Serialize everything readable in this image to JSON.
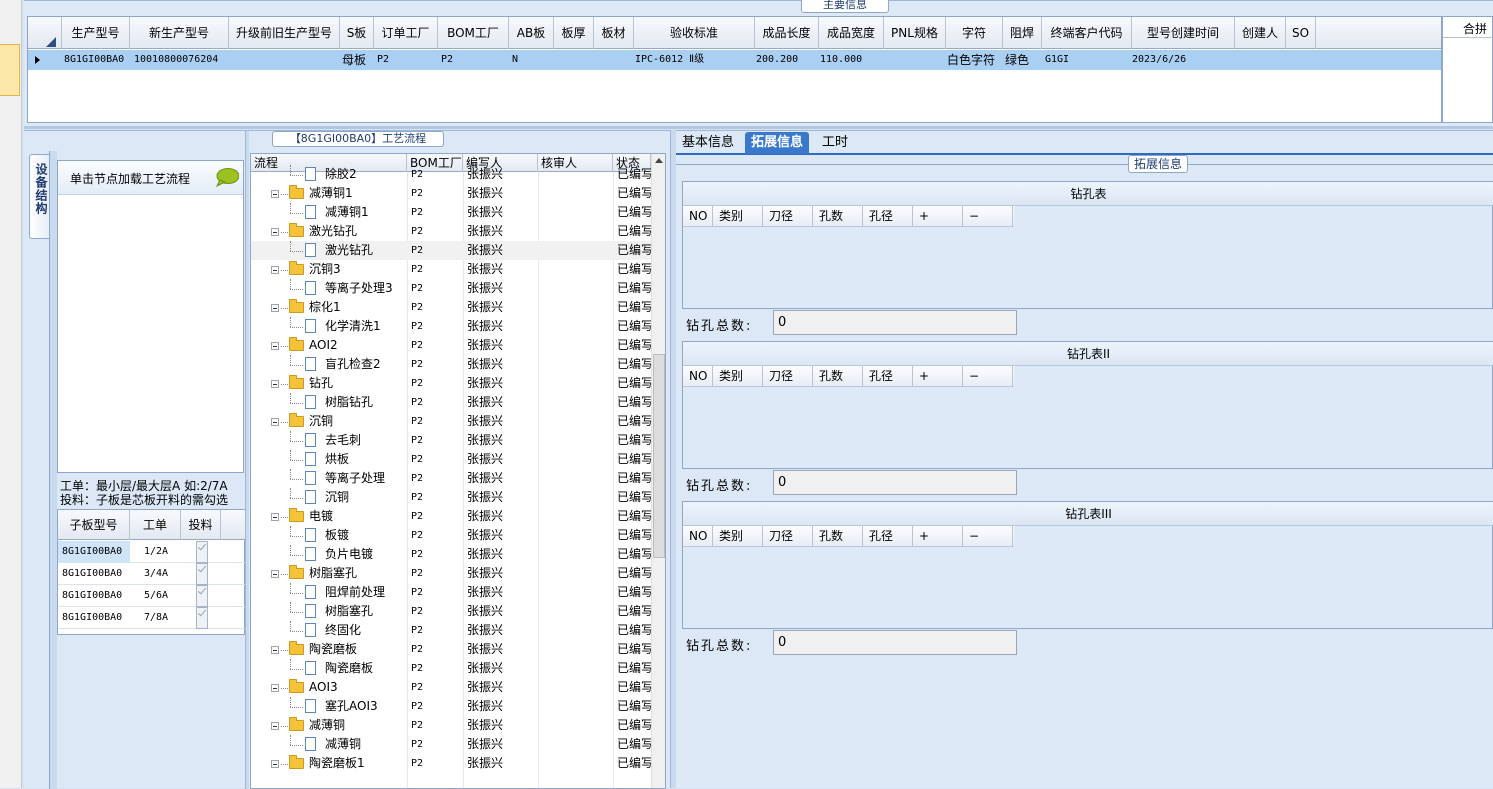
{
  "top_panel": {
    "title": "主要信息",
    "columns": [
      "生产型号",
      "新生产型号",
      "升级前旧生产型号",
      "S板",
      "订单工厂",
      "BOM工厂",
      "AB板",
      "板厚",
      "板材",
      "验收标准",
      "成品长度",
      "成品宽度",
      "PNL规格",
      "字符",
      "阻焊",
      "终端客户代码",
      "型号创建时间",
      "创建人",
      "SO"
    ],
    "row": {
      "prod_model": "8G1GI00BA0",
      "new_model": "10010800076204",
      "old_model": "",
      "s_board": "母板",
      "order_factory": "P2",
      "bom_factory": "P2",
      "ab_board": "N",
      "thickness": "",
      "material": "",
      "acceptance": "IPC-6012 Ⅱ级",
      "length": "200.200",
      "width": "110.000",
      "pnl": "",
      "character": "白色字符",
      "solder": "绿色",
      "customer_code": "G1GI",
      "created": "2023/6/26",
      "creator": "",
      "so": ""
    },
    "merge_label": "合拼"
  },
  "left_panel": {
    "flow_title": "【8G1GI00BA0】工艺流程",
    "vertical_tab": "设备结构",
    "node_hint": "单击节点加载工艺流程",
    "hint_line1": "工单：最小层/最大层A 如:2/7A",
    "hint_line2": "投料：子板是芯板开料的需勾选",
    "sub_columns": [
      "子板型号",
      "工单",
      "投料"
    ],
    "sub_rows": [
      {
        "model": "8G1GI00BA0",
        "order": "1/2A"
      },
      {
        "model": "8G1GI00BA0",
        "order": "3/4A"
      },
      {
        "model": "8G1GI00BA0",
        "order": "5/6A"
      },
      {
        "model": "8G1GI00BA0",
        "order": "7/8A"
      }
    ]
  },
  "tree": {
    "columns": [
      "流程",
      "BOM工厂",
      "编写人",
      "核审人",
      "状态"
    ],
    "rows": [
      {
        "name": "除胶2",
        "kind": "doc",
        "bom": "P2",
        "writer": "张振兴",
        "status": "已编写"
      },
      {
        "name": "减薄铜1",
        "kind": "folder",
        "bom": "P2",
        "writer": "张振兴",
        "status": "已编写"
      },
      {
        "name": "减薄铜1",
        "kind": "doc",
        "bom": "P2",
        "writer": "张振兴",
        "status": "已编写"
      },
      {
        "name": "激光钻孔",
        "kind": "folder",
        "bom": "P2",
        "writer": "张振兴",
        "status": "已编写"
      },
      {
        "name": "激光钻孔",
        "kind": "doc",
        "bom": "P2",
        "writer": "张振兴",
        "status": "已编写"
      },
      {
        "name": "沉铜3",
        "kind": "folder",
        "bom": "P2",
        "writer": "张振兴",
        "status": "已编写"
      },
      {
        "name": "等离子处理3",
        "kind": "doc",
        "bom": "P2",
        "writer": "张振兴",
        "status": "已编写"
      },
      {
        "name": "棕化1",
        "kind": "folder",
        "bom": "P2",
        "writer": "张振兴",
        "status": "已编写"
      },
      {
        "name": "化学清洗1",
        "kind": "doc",
        "bom": "P2",
        "writer": "张振兴",
        "status": "已编写"
      },
      {
        "name": "AOI2",
        "kind": "folder",
        "bom": "P2",
        "writer": "张振兴",
        "status": "已编写"
      },
      {
        "name": "盲孔检查2",
        "kind": "doc",
        "bom": "P2",
        "writer": "张振兴",
        "status": "已编写"
      },
      {
        "name": "钻孔",
        "kind": "folder",
        "bom": "P2",
        "writer": "张振兴",
        "status": "已编写"
      },
      {
        "name": "树脂钻孔",
        "kind": "doc",
        "bom": "P2",
        "writer": "张振兴",
        "status": "已编写"
      },
      {
        "name": "沉铜",
        "kind": "folder",
        "bom": "P2",
        "writer": "张振兴",
        "status": "已编写"
      },
      {
        "name": "去毛刺",
        "kind": "doc",
        "bom": "P2",
        "writer": "张振兴",
        "status": "已编写"
      },
      {
        "name": "烘板",
        "kind": "doc",
        "bom": "P2",
        "writer": "张振兴",
        "status": "已编写"
      },
      {
        "name": "等离子处理",
        "kind": "doc",
        "bom": "P2",
        "writer": "张振兴",
        "status": "已编写"
      },
      {
        "name": "沉铜",
        "kind": "doc",
        "bom": "P2",
        "writer": "张振兴",
        "status": "已编写"
      },
      {
        "name": "电镀",
        "kind": "folder",
        "bom": "P2",
        "writer": "张振兴",
        "status": "已编写"
      },
      {
        "name": "板镀",
        "kind": "doc",
        "bom": "P2",
        "writer": "张振兴",
        "status": "已编写"
      },
      {
        "name": "负片电镀",
        "kind": "doc",
        "bom": "P2",
        "writer": "张振兴",
        "status": "已编写"
      },
      {
        "name": "树脂塞孔",
        "kind": "folder",
        "bom": "P2",
        "writer": "张振兴",
        "status": "已编写"
      },
      {
        "name": "阻焊前处理",
        "kind": "doc",
        "bom": "P2",
        "writer": "张振兴",
        "status": "已编写"
      },
      {
        "name": "树脂塞孔",
        "kind": "doc",
        "bom": "P2",
        "writer": "张振兴",
        "status": "已编写"
      },
      {
        "name": "终固化",
        "kind": "doc",
        "bom": "P2",
        "writer": "张振兴",
        "status": "已编写"
      },
      {
        "name": "陶瓷磨板",
        "kind": "folder",
        "bom": "P2",
        "writer": "张振兴",
        "status": "已编写"
      },
      {
        "name": "陶瓷磨板",
        "kind": "doc",
        "bom": "P2",
        "writer": "张振兴",
        "status": "已编写"
      },
      {
        "name": "AOI3",
        "kind": "folder",
        "bom": "P2",
        "writer": "张振兴",
        "status": "已编写"
      },
      {
        "name": "塞孔AOI3",
        "kind": "doc",
        "bom": "P2",
        "writer": "张振兴",
        "status": "已编写"
      },
      {
        "name": "减薄铜",
        "kind": "folder",
        "bom": "P2",
        "writer": "张振兴",
        "status": "已编写"
      },
      {
        "name": "减薄铜",
        "kind": "doc",
        "bom": "P2",
        "writer": "张振兴",
        "status": "已编写"
      },
      {
        "name": "陶瓷磨板1",
        "kind": "folder",
        "bom": "P2",
        "writer": "张振兴",
        "status": "已编写"
      }
    ]
  },
  "right_panel": {
    "tabs": [
      "基本信息",
      "拓展信息",
      "工时"
    ],
    "active_tab": "拓展信息",
    "section_title": "拓展信息",
    "drill_columns": [
      "NO",
      "类别",
      "刀径",
      "孔数",
      "孔径",
      "+",
      "−"
    ],
    "total_label": "钻孔总数:",
    "tables": [
      {
        "title": "钻孔表",
        "total": "0"
      },
      {
        "title": "钻孔表II",
        "total": "0"
      },
      {
        "title": "钻孔表III",
        "total": "0"
      }
    ]
  }
}
